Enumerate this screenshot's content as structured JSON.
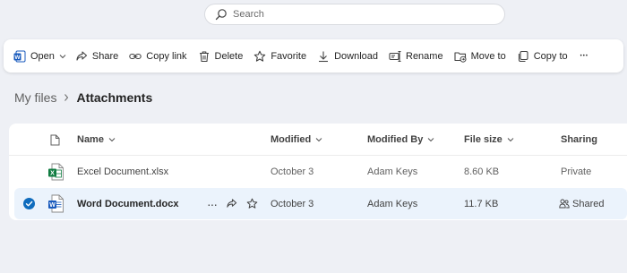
{
  "search": {
    "placeholder": "Search"
  },
  "toolbar": {
    "open": "Open",
    "share": "Share",
    "copy_link": "Copy link",
    "delete": "Delete",
    "favorite": "Favorite",
    "download": "Download",
    "rename": "Rename",
    "move_to": "Move to",
    "copy_to": "Copy to",
    "more": "•••"
  },
  "breadcrumb": {
    "root": "My files",
    "current": "Attachments"
  },
  "table": {
    "columns": {
      "name": "Name",
      "modified": "Modified",
      "modified_by": "Modified By",
      "file_size": "File size",
      "sharing": "Sharing"
    },
    "rows": [
      {
        "name": "Excel Document.xlsx",
        "modified": "October 3",
        "modified_by": "Adam Keys",
        "file_size": "8.60 KB",
        "sharing": "Private",
        "selected": false
      },
      {
        "name": "Word Document.docx",
        "modified": "October 3",
        "modified_by": "Adam Keys",
        "file_size": "11.7 KB",
        "sharing": "Shared",
        "selected": true
      }
    ],
    "row_more": "···"
  },
  "colors": {
    "word": "#185abd",
    "excel": "#107c41",
    "accent": "#0f6cbd",
    "selected_row": "#ebf3fc"
  }
}
